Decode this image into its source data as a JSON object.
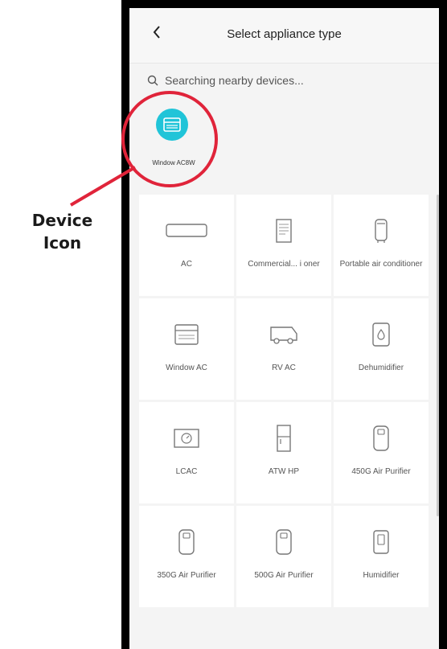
{
  "header": {
    "title": "Select appliance type",
    "back_icon": "chevron-left-icon"
  },
  "search": {
    "text": "Searching nearby devices...",
    "icon": "search-icon"
  },
  "found_device": {
    "label": "Window AC8W",
    "icon": "window-ac-icon",
    "color": "#20c4d8"
  },
  "appliances": [
    {
      "label": "AC",
      "icon": "ac-icon"
    },
    {
      "label": "Commercial... i oner",
      "icon": "commercial-ac-icon"
    },
    {
      "label": "Portable air conditioner",
      "icon": "portable-ac-icon"
    },
    {
      "label": "Window AC",
      "icon": "window-ac-icon"
    },
    {
      "label": "RV AC",
      "icon": "rv-ac-icon"
    },
    {
      "label": "Dehumidifier",
      "icon": "dehumidifier-icon"
    },
    {
      "label": "LCAC",
      "icon": "lcac-icon"
    },
    {
      "label": "ATW HP",
      "icon": "atw-hp-icon"
    },
    {
      "label": "450G Air Purifier",
      "icon": "air-purifier-icon"
    },
    {
      "label": "350G Air Purifier",
      "icon": "air-purifier-icon"
    },
    {
      "label": "500G Air Purifier",
      "icon": "air-purifier-icon"
    },
    {
      "label": "Humidifier",
      "icon": "humidifier-icon"
    }
  ],
  "annotation": {
    "line1": "Device",
    "line2": "Icon",
    "color": "#e0243a"
  }
}
